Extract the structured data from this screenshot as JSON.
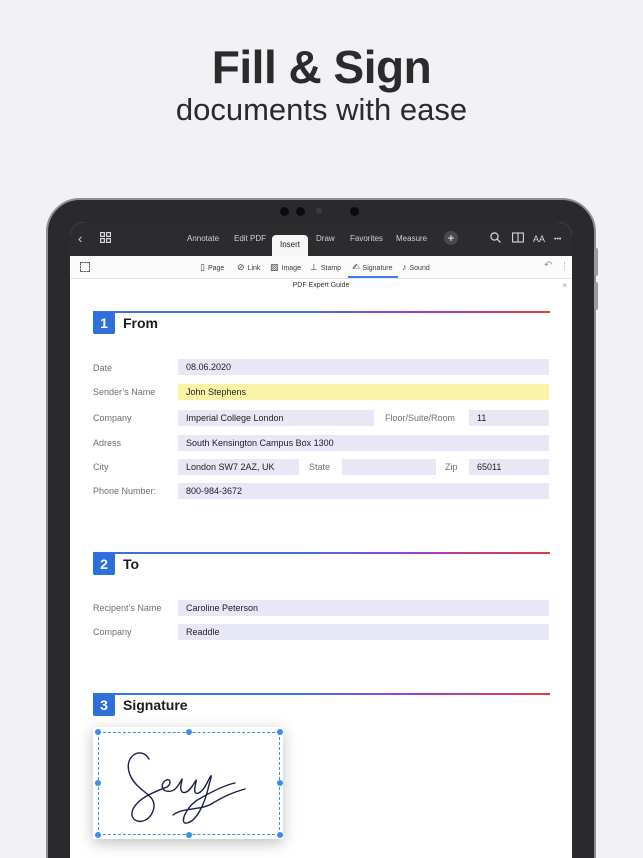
{
  "hero": {
    "title": "Fill & Sign",
    "subtitle": "documents with ease"
  },
  "toolbar": {
    "tabs": [
      "Annotate",
      "Edit PDF",
      "Insert",
      "Draw",
      "Favorites",
      "Measure"
    ],
    "active_tab": "Insert",
    "icons": [
      "back-icon",
      "grid-icon",
      "plus-icon",
      "search-icon",
      "book-icon",
      "text-size-icon",
      "more-icon"
    ],
    "text_size_glyph": "AA",
    "more_glyph": "•••"
  },
  "insert_tools": {
    "items": [
      {
        "label": "Page",
        "icon": "page-plus-icon"
      },
      {
        "label": "Link",
        "icon": "link-icon"
      },
      {
        "label": "Image",
        "icon": "image-icon"
      },
      {
        "label": "Stamp",
        "icon": "stamp-icon"
      },
      {
        "label": "Signature",
        "icon": "signature-icon"
      },
      {
        "label": "Sound",
        "icon": "microphone-icon"
      }
    ],
    "active_tool": "Signature",
    "accent": "#3c7ef0"
  },
  "document": {
    "title": "PDF Expert Guide"
  },
  "section_from": {
    "number": "1",
    "title": "From",
    "date_label": "Date",
    "date_value": "08.06.2020",
    "sender_label": "Sender’s Name",
    "sender_value": "John Stephens",
    "company_label": "Company",
    "company_value": "Imperial College London",
    "floor_label": "Floor/Suite/Room",
    "floor_value": "11",
    "address_label": "Adress",
    "address_value": "South Kensington Campus Box 1300",
    "city_label": "City",
    "city_value": "London SW7 2AZ, UK",
    "state_label": "State",
    "state_value": "",
    "zip_label": "Zip",
    "zip_value": "65011",
    "phone_label": "Phone Number:",
    "phone_value": "800-984-3672"
  },
  "section_to": {
    "number": "2",
    "title": "To",
    "recipient_label": "Recipent’s Name",
    "recipient_value": "Caroline Peterson",
    "company_label": "Company",
    "company_value": "Readdle"
  },
  "section_signature": {
    "number": "3",
    "title": "Signature"
  },
  "colors": {
    "section_badge": "#2f6fdd",
    "field_fill": "#e8e7f6",
    "highlight_field": "#fbf4a6",
    "selection_handle": "#3a8ef0"
  }
}
